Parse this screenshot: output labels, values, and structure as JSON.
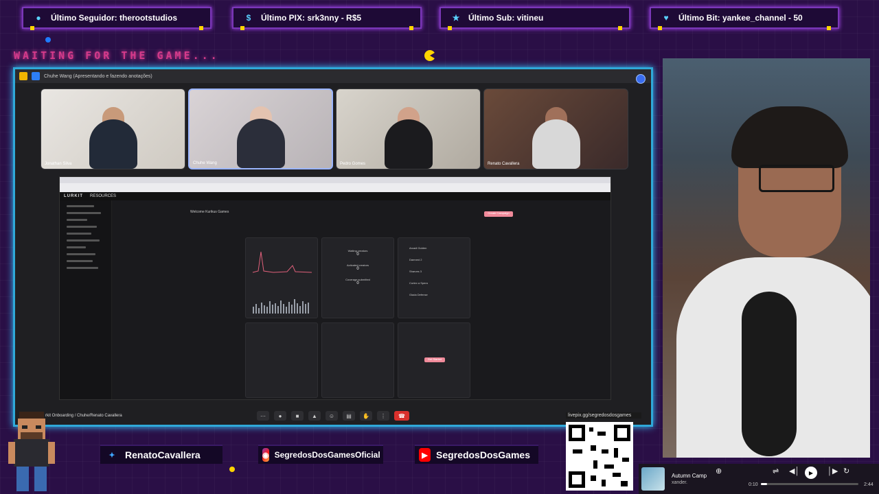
{
  "alerts": [
    {
      "icon": "user-icon",
      "label": "Último Seguidor: therootstudios"
    },
    {
      "icon": "pix-icon",
      "label": "Último PIX: srk3nny - R$5"
    },
    {
      "icon": "star-icon",
      "label": "Último Sub: vitineu"
    },
    {
      "icon": "heart-icon",
      "label": "Último Bit: yankee_channel - 50"
    }
  ],
  "banner": {
    "waiting": "WAITING FOR THE GAME..."
  },
  "meeting": {
    "title": "Chuhe Wang (Apresentando e fazendo anotações)",
    "participants": [
      {
        "name": "Jonathan Silva"
      },
      {
        "name": "Chuhe Wang"
      },
      {
        "name": "Pedro Gomes"
      },
      {
        "name": "Renato Cavallera"
      }
    ],
    "breadcrumb": "rkit Onboarding / Chuhe/Renato Cavallera"
  },
  "app": {
    "brand": "LURKIT",
    "nav": "RESOURCES",
    "welcome": "Welcome Kurikus Games",
    "create_button": "Create Campaign",
    "waiting_creators_label": "Waiting creators",
    "waiting_creators_value": "0",
    "activated_creators_label": "Activated creators",
    "activated_creators_value": "0",
    "coverage_label": "Coverage submitted",
    "coverage_value": "0",
    "games": [
      "Arcadi Golden",
      "Damned 2",
      "Sharves 3",
      "Cortex a Spera",
      "Giada Defense"
    ],
    "get_started": "Get Started"
  },
  "socials": {
    "twitter": "RenatoCavallera",
    "instagram": "SegredosDosGamesOficial",
    "youtube": "SegredosDosGames"
  },
  "qr": {
    "url": "livepix.gg/segredosdosgames"
  },
  "player": {
    "song": "Autumn Camp",
    "artist": "xander.",
    "elapsed": "0:10",
    "duration": "2:44",
    "progress": 0.06
  },
  "colors": {
    "background": "#2a0f46",
    "frame": "#2fa9d9",
    "alert_border": "#7a37b8",
    "accent_yellow": "#ffd400",
    "banner_pink": "#d43a8a"
  }
}
